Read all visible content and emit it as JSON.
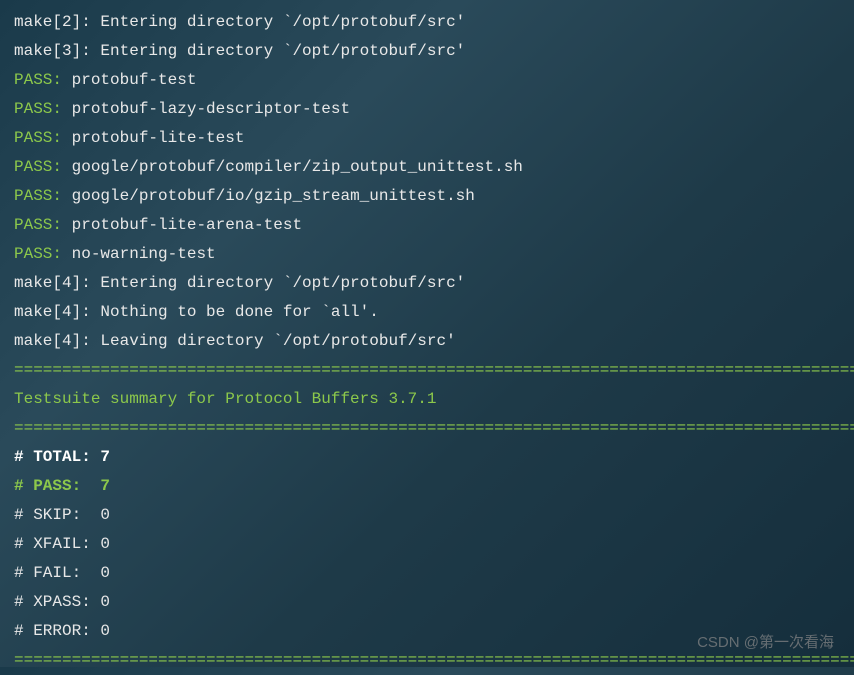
{
  "lines": [
    {
      "segments": [
        {
          "class": "white",
          "text": "make[2]: Entering directory `/opt/protobuf/src'"
        }
      ]
    },
    {
      "segments": [
        {
          "class": "white",
          "text": "make[3]: Entering directory `/opt/protobuf/src'"
        }
      ]
    },
    {
      "segments": [
        {
          "class": "green",
          "text": "PASS:"
        },
        {
          "class": "white",
          "text": " protobuf-test"
        }
      ]
    },
    {
      "segments": [
        {
          "class": "green",
          "text": "PASS:"
        },
        {
          "class": "white",
          "text": " protobuf-lazy-descriptor-test"
        }
      ]
    },
    {
      "segments": [
        {
          "class": "green",
          "text": "PASS:"
        },
        {
          "class": "white",
          "text": " protobuf-lite-test"
        }
      ]
    },
    {
      "segments": [
        {
          "class": "green",
          "text": "PASS:"
        },
        {
          "class": "white",
          "text": " google/protobuf/compiler/zip_output_unittest.sh"
        }
      ]
    },
    {
      "segments": [
        {
          "class": "green",
          "text": "PASS:"
        },
        {
          "class": "white",
          "text": " google/protobuf/io/gzip_stream_unittest.sh"
        }
      ]
    },
    {
      "segments": [
        {
          "class": "green",
          "text": "PASS:"
        },
        {
          "class": "white",
          "text": " protobuf-lite-arena-test"
        }
      ]
    },
    {
      "segments": [
        {
          "class": "green",
          "text": "PASS:"
        },
        {
          "class": "white",
          "text": " no-warning-test"
        }
      ]
    },
    {
      "segments": [
        {
          "class": "white",
          "text": "make[4]: Entering directory `/opt/protobuf/src'"
        }
      ]
    },
    {
      "segments": [
        {
          "class": "white",
          "text": "make[4]: Nothing to be done for `all'."
        }
      ]
    },
    {
      "segments": [
        {
          "class": "white",
          "text": "make[4]: Leaving directory `/opt/protobuf/src'"
        }
      ]
    },
    {
      "segments": [
        {
          "class": "green",
          "text": "============================================================================================"
        }
      ]
    },
    {
      "segments": [
        {
          "class": "green",
          "text": "Testsuite summary for Protocol Buffers 3.7.1"
        }
      ]
    },
    {
      "segments": [
        {
          "class": "green",
          "text": "============================================================================================"
        }
      ]
    },
    {
      "segments": [
        {
          "class": "bold-white",
          "text": "# TOTAL: 7"
        }
      ]
    },
    {
      "segments": [
        {
          "class": "bold-green",
          "text": "# PASS:  7"
        }
      ]
    },
    {
      "segments": [
        {
          "class": "white",
          "text": "# SKIP:  0"
        }
      ]
    },
    {
      "segments": [
        {
          "class": "white",
          "text": "# XFAIL: 0"
        }
      ]
    },
    {
      "segments": [
        {
          "class": "white",
          "text": "# FAIL:  0"
        }
      ]
    },
    {
      "segments": [
        {
          "class": "white",
          "text": "# XPASS: 0"
        }
      ]
    },
    {
      "segments": [
        {
          "class": "white",
          "text": "# ERROR: 0"
        }
      ]
    },
    {
      "segments": [
        {
          "class": "green",
          "text": "============================================================================================"
        }
      ]
    }
  ],
  "watermark": "CSDN @第一次看海"
}
